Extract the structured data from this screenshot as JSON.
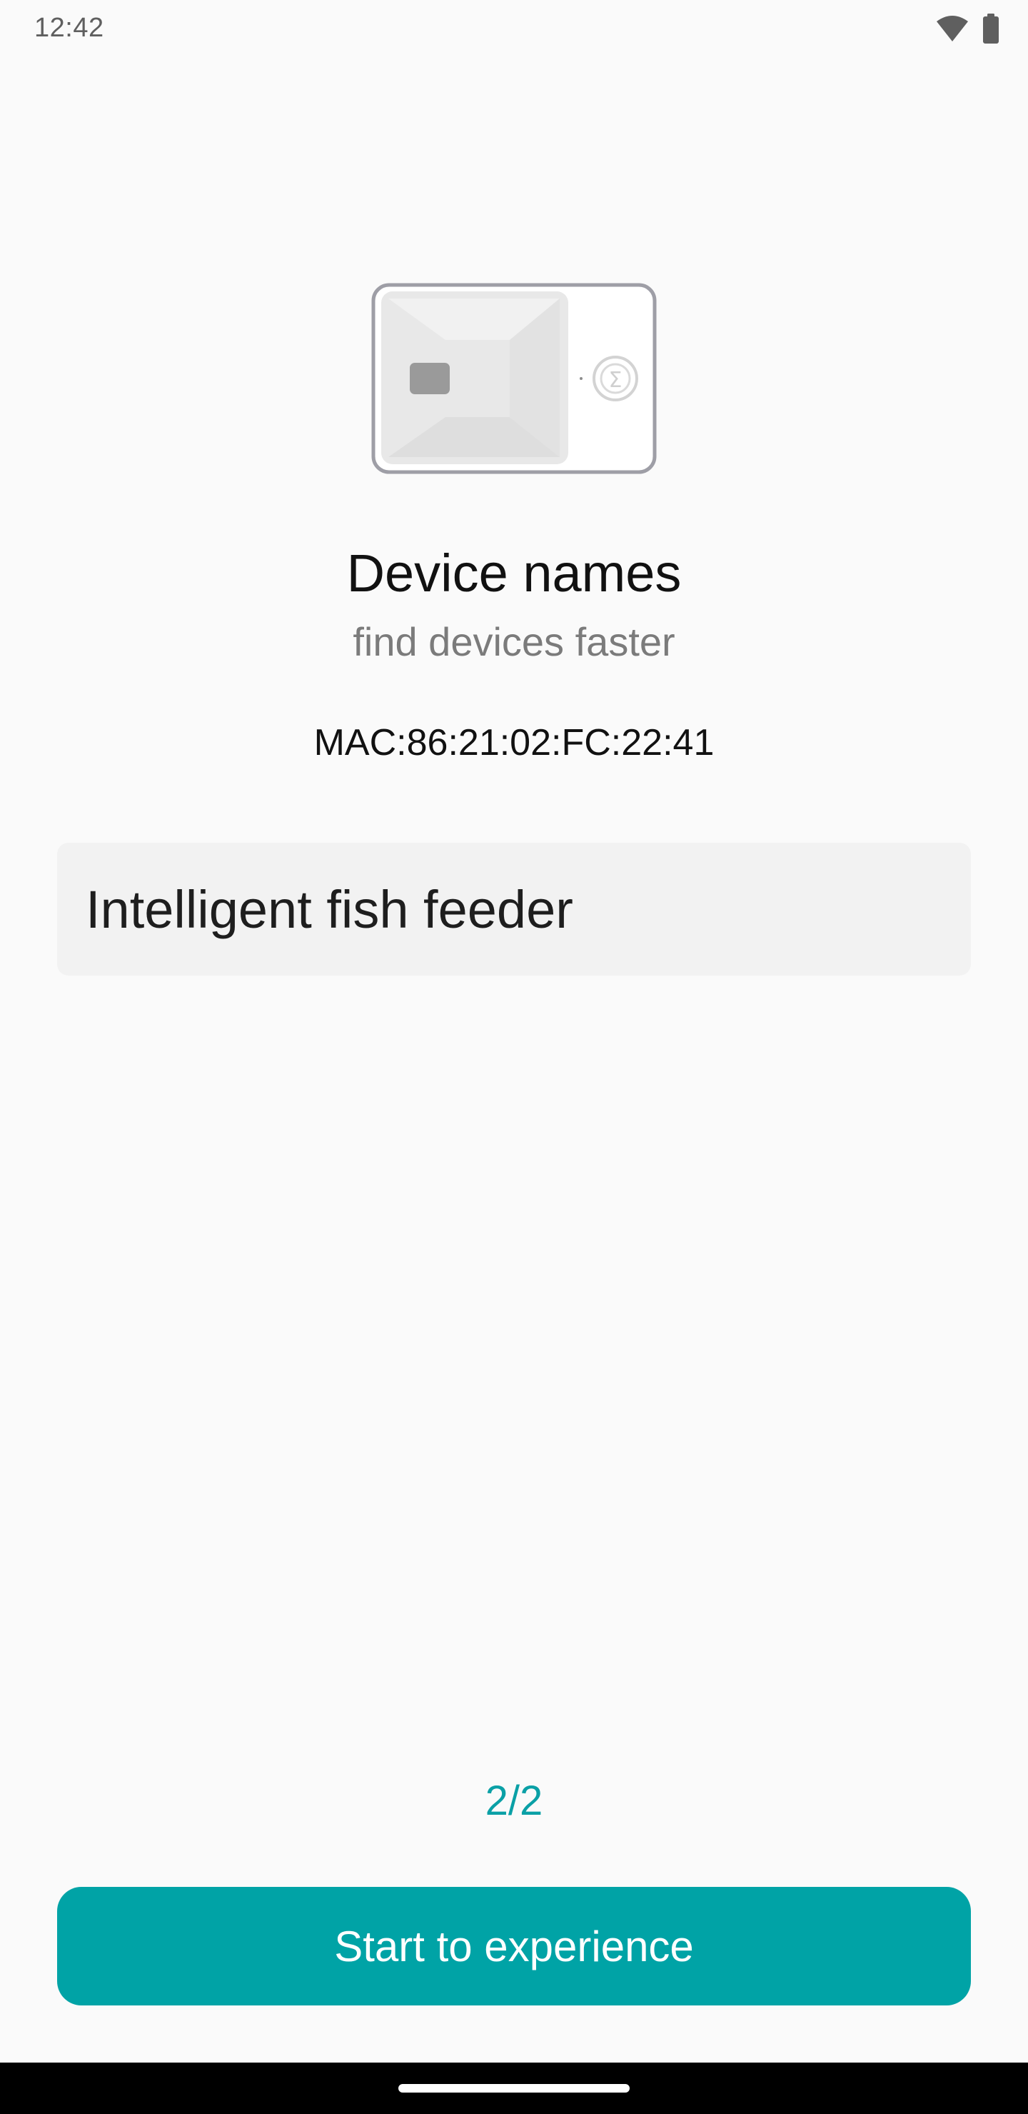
{
  "status_bar": {
    "time": "12:42",
    "icons": [
      "wifi-icon",
      "battery-icon"
    ]
  },
  "device": {
    "illustration": "fish-feeder-device"
  },
  "header": {
    "title": "Device names",
    "subtitle": "find devices faster"
  },
  "mac_label": "MAC:86:21:02:FC:22:41",
  "name_input": {
    "value": "Intelligent fish feeder"
  },
  "pager": {
    "text": "2/2"
  },
  "start_button": {
    "label": "Start to experience"
  },
  "colors": {
    "accent": "#00a3a6",
    "background": "#fafafa",
    "field_background": "#f2f2f2"
  }
}
